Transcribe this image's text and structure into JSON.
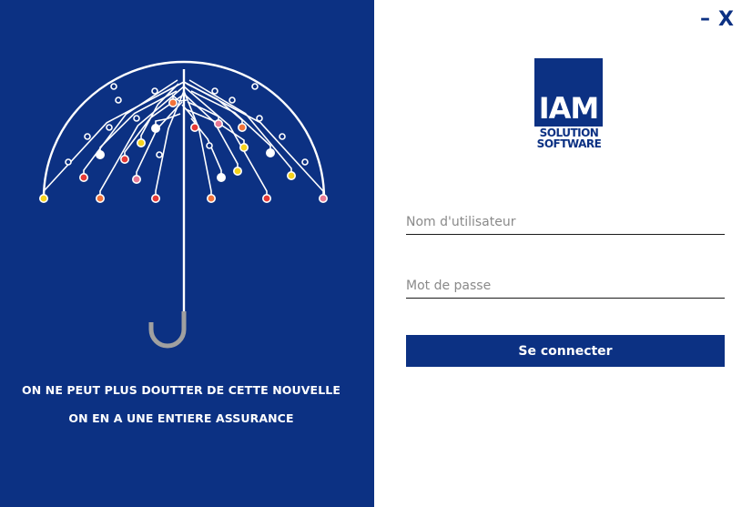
{
  "left_panel": {
    "slogan_line1": "ON NE PEUT PLUS DOUTTER DE CETTE NOUVELLE",
    "slogan_line2": "ON EN A UNE ENTIERE ASSURANCE",
    "illustration": "circuit-umbrella-illustration",
    "background_color": "#0c3183"
  },
  "window_controls": {
    "minimize_label": "–",
    "close_label": "X"
  },
  "logo": {
    "main": "IAM",
    "line1": "SOLUTION",
    "line2": "SOFTWARE"
  },
  "form": {
    "username_placeholder": "Nom d'utilisateur",
    "username_value": "",
    "password_placeholder": "Mot de passe",
    "password_value": "",
    "submit_label": "Se connecter"
  },
  "colors": {
    "brand": "#0c3183",
    "dot_red": "#e53935",
    "dot_yellow": "#f5d21c",
    "dot_pink": "#e87a95",
    "dot_orange": "#f2733a",
    "handle_gray": "#a0a0a0"
  }
}
